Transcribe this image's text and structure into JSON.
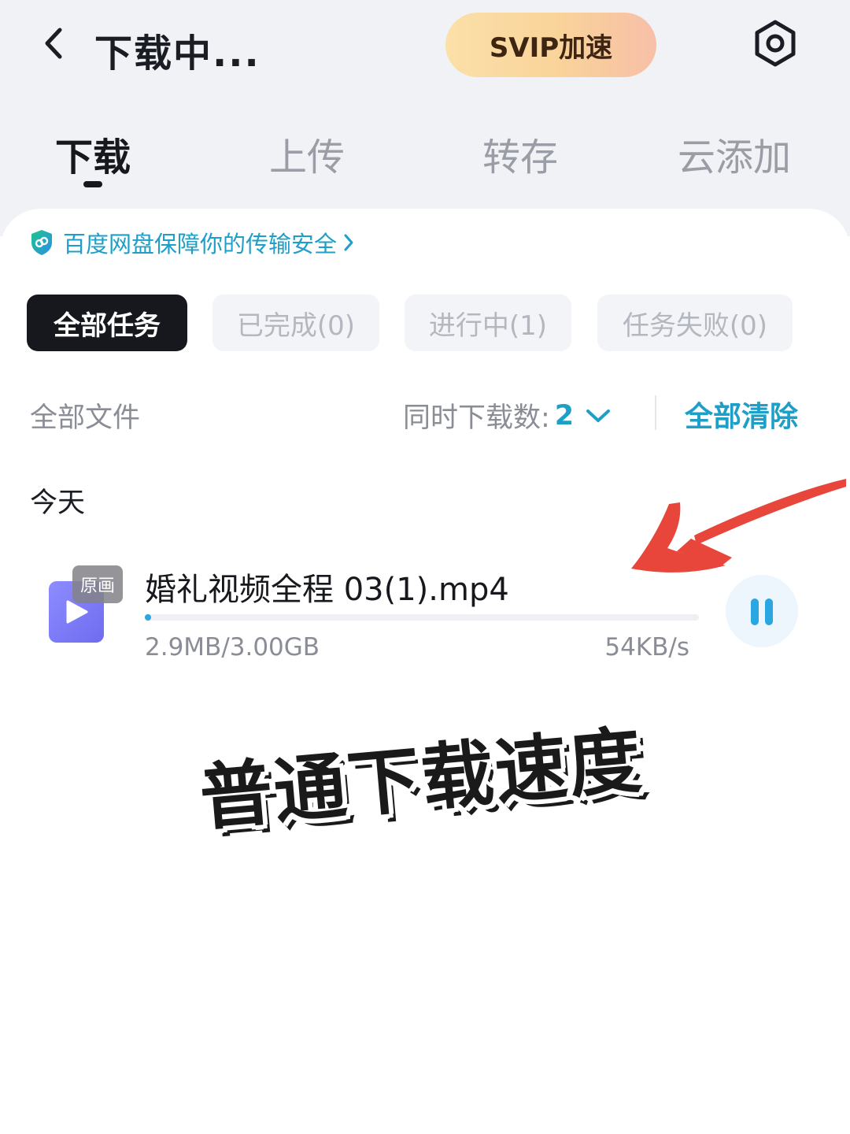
{
  "header": {
    "title": "下载中...",
    "svip_label": "SVIP加速",
    "back_icon": "chevron-left-icon",
    "settings_icon": "hexagon-gear-icon"
  },
  "tabs": [
    {
      "label": "下载",
      "active": true
    },
    {
      "label": "上传",
      "active": false
    },
    {
      "label": "转存",
      "active": false
    },
    {
      "label": "云添加",
      "active": false
    }
  ],
  "notice": {
    "text": "百度网盘保障你的传输安全",
    "icon": "shield-icon"
  },
  "filters": [
    {
      "label": "全部任务",
      "active": true
    },
    {
      "label": "已完成(0)",
      "active": false
    },
    {
      "label": "进行中(1)",
      "active": false
    },
    {
      "label": "任务失败(0)",
      "active": false
    }
  ],
  "toolbar": {
    "files_label": "全部文件",
    "concurrent_label": "同时下载数:",
    "concurrent_value": "2",
    "clear_all": "全部清除"
  },
  "list": {
    "section_title": "今天",
    "items": [
      {
        "badge": "原画",
        "name": "婚礼视频全程 03(1).mp4",
        "size": "2.9MB/3.00GB",
        "speed": "54KB/s",
        "progress": 0.001,
        "state": "downloading"
      }
    ]
  },
  "overlay": {
    "caption": "普通下载速度"
  },
  "colors": {
    "accent": "#1d9fc7",
    "progress": "#2aa7e0",
    "annotation_arrow": "#e8463a",
    "top_background": "#f1f2f6"
  }
}
